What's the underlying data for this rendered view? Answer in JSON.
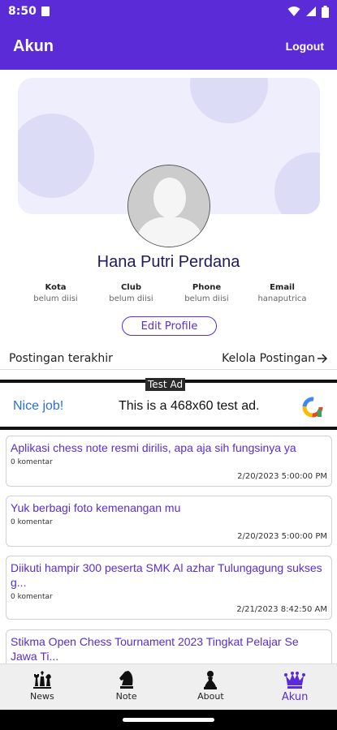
{
  "status_bar": {
    "time": "8:50"
  },
  "app_bar": {
    "title": "Akun",
    "logout_label": "Logout"
  },
  "profile": {
    "name": "Hana Putri Perdana",
    "fields": [
      {
        "label": "Kota",
        "value": "belum diisi"
      },
      {
        "label": "Club",
        "value": "belum diisi"
      },
      {
        "label": "Phone",
        "value": "belum diisi"
      },
      {
        "label": "Email",
        "value": "hanaputrica"
      }
    ],
    "edit_label": "Edit Profile"
  },
  "posts_section": {
    "title": "Postingan terakhir",
    "manage_label": "Kelola Postingan"
  },
  "ad": {
    "badge": "Test Ad",
    "headline": "Nice job!",
    "text": "This is a 468x60 test ad."
  },
  "posts": [
    {
      "title": "Aplikasi chess note resmi dirilis, apa aja sih fungsinya ya",
      "comments": "0 komentar",
      "date": "2/20/2023 5:00:00 PM"
    },
    {
      "title": "Yuk berbagi foto kemenangan mu",
      "comments": "0 komentar",
      "date": "2/20/2023 5:00:00 PM"
    },
    {
      "title": "Diikuti hampir 300 peserta SMK Al azhar Tulungagung sukses g...",
      "comments": "0 komentar",
      "date": "2/21/2023 8:42:50 AM"
    },
    {
      "title": "Stikma Open Chess Tournament 2023 Tingkat Pelajar Se Jawa Ti...",
      "comments": "",
      "date": ""
    }
  ],
  "nav": [
    {
      "label": "News",
      "icon": "chess-pieces-icon",
      "active": false
    },
    {
      "label": "Note",
      "icon": "chess-knight-icon",
      "active": false
    },
    {
      "label": "About",
      "icon": "chess-pawn-icon",
      "active": false
    },
    {
      "label": "Akun",
      "icon": "chess-king-icon",
      "active": true
    }
  ],
  "colors": {
    "primary": "#5a2bd6",
    "cover": "#eeeefc",
    "cover_circle": "#dcdcf6"
  }
}
